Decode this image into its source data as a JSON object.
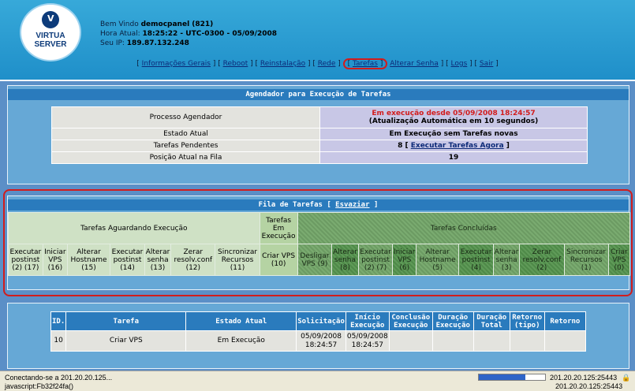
{
  "header": {
    "logo_line1": "VIRTUA",
    "logo_line2": "SERVER",
    "welcome_prefix": "Bem Vindo ",
    "welcome_user": "democpanel (821)",
    "time_label": "Hora Atual: ",
    "time_value": "18:25:22 - UTC-0300 - 05/09/2008",
    "ip_label": "Seu IP: ",
    "ip_value": "189.87.132.248"
  },
  "nav": {
    "items": [
      {
        "label": "Informações Gerais"
      },
      {
        "label": "Reboot"
      },
      {
        "label": "Reinstalação"
      },
      {
        "label": "Rede"
      },
      {
        "label": "Tarefas"
      },
      {
        "label": "Alterar Senha"
      },
      {
        "label": "Logs"
      },
      {
        "label": "Sair"
      }
    ]
  },
  "scheduler": {
    "title": "Agendador para Execução de Tarefas",
    "rows": [
      {
        "label": "Processo Agendador",
        "value": "Em execução desde 05/09/2008 18:24:57",
        "value2": "(Atualização Automática em 10 segundos)"
      },
      {
        "label": "Estado Atual",
        "value": "Em Execução sem Tarefas novas"
      },
      {
        "label": "Tarefas Pendentes",
        "value": "8",
        "link": "Executar Tarefas Agora"
      },
      {
        "label": "Posição Atual na Fila",
        "value": "19"
      }
    ]
  },
  "queue": {
    "title": "Fila de Tarefas",
    "clear_link": "Esvaziar",
    "group_waiting": "Tarefas Aguardando Execução",
    "group_running": "Tarefas Em Execução",
    "group_done": "Tarefas Concluídas",
    "cells": [
      "Executar postinst (2) (17)",
      "Iniciar VPS (16)",
      "Alterar Hostname (15)",
      "Executar postinst (14)",
      "Alterar senha (13)",
      "Zerar resolv.conf (12)",
      "Sincronizar Recursos (11)",
      "Criar VPS (10)",
      "Desligar VPS (9)",
      "Alterar senha (8)",
      "Executar postinst (2) (7)",
      "Iniciar VPS (6)",
      "Alterar Hostname (5)",
      "Executar postinst (4)",
      "Alterar senha (3)",
      "Zerar resolv.conf (2)",
      "Sincronizar Recursos (1)",
      "Criar VPS (0)"
    ]
  },
  "jobs": {
    "headers": [
      "ID.",
      "Tarefa",
      "Estado Atual",
      "Solicitação",
      "Início Execução",
      "Conclusão Execução",
      "Duração Execução",
      "Duração Total",
      "Retorno (tipo)",
      "Retorno"
    ],
    "rows": [
      {
        "id": "10",
        "task": "Criar VPS",
        "state": "Em Execução",
        "requested": "05/09/2008 18:24:57",
        "started": "05/09/2008 18:24:57",
        "finished": "",
        "dur_exec": "",
        "dur_total": "",
        "ret_type": "",
        "ret": ""
      }
    ]
  },
  "statusbar": {
    "line1": "Conectando-se a 201.20.20.125...",
    "line2": "javascript:Fb32f24fa()",
    "ip1": "201.20.20.125:25443",
    "ip2": "201.20.20.125:25443",
    "progress": 0.7
  },
  "colors": {
    "accent_red": "#d21c1c",
    "header_blue": "#2a7bbd"
  }
}
